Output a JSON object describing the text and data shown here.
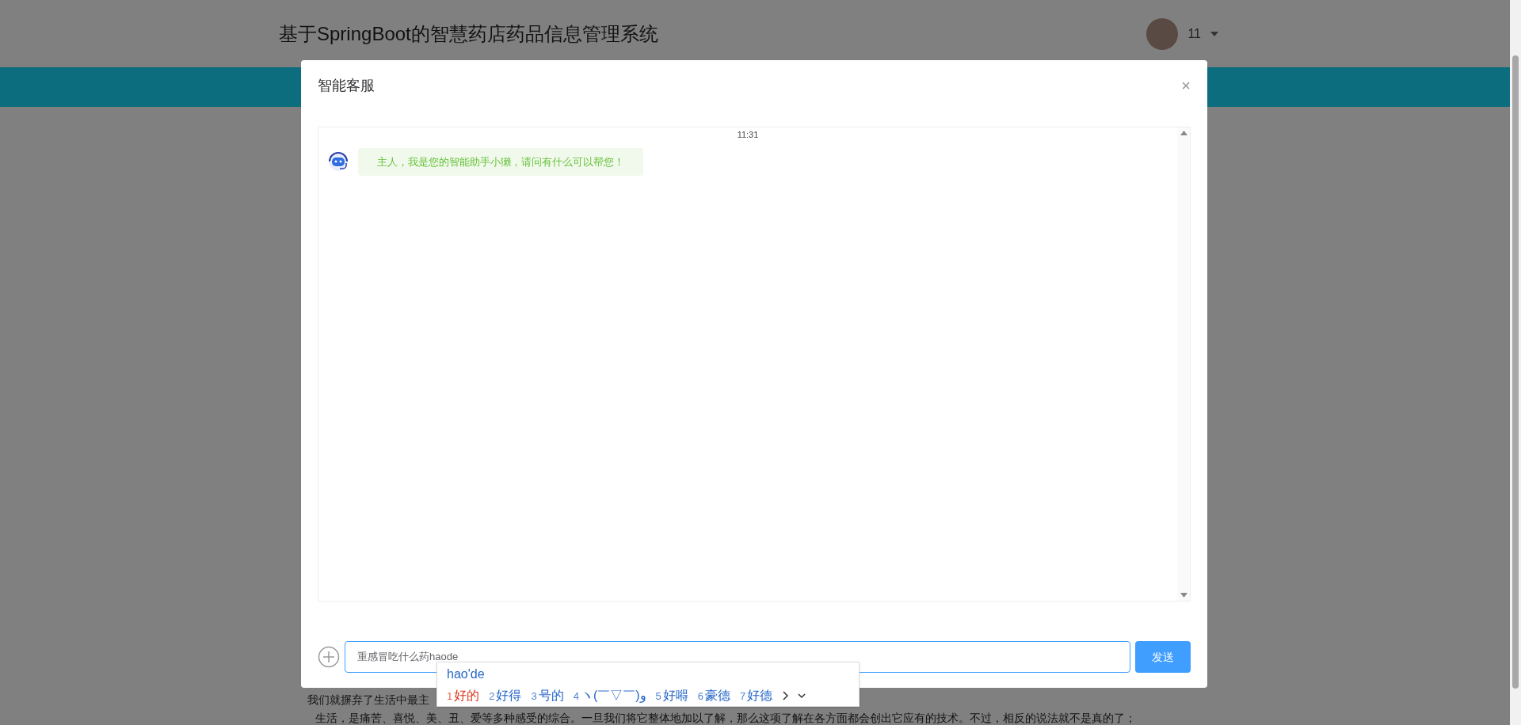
{
  "header": {
    "title": "基于SpringBoot的智慧药店药品信息管理系统",
    "user": {
      "name": "11"
    }
  },
  "background_text": [
    "我们就摒弃了生活中最主",
    "生活，是痛苦、喜悦、美、丑、爱等多种感受的综合。一旦我们将它整体地加以了解，那么这项了解在各方面都会创出它应有的技术。不过，相反的说法就不是真的了；"
  ],
  "dialog": {
    "title": "智能客服",
    "close": "×",
    "messages": [
      {
        "time": "11:31",
        "kind": "bot",
        "text": "主人，我是您的智能助手小獺，请问有什么可以帮您！"
      }
    ],
    "input": {
      "value": "重感冒吃什么药haode"
    },
    "send_button": "发送"
  },
  "ime": {
    "composition": "hao'de",
    "candidates": [
      {
        "index": "1",
        "text": "好的",
        "selected": true
      },
      {
        "index": "2",
        "text": "好得",
        "selected": false
      },
      {
        "index": "3",
        "text": "号的",
        "selected": false
      },
      {
        "index": "4",
        "text": "ヽ(￣▽￣)و",
        "selected": false
      },
      {
        "index": "5",
        "text": "好嘚",
        "selected": false
      },
      {
        "index": "6",
        "text": "豪德",
        "selected": false
      },
      {
        "index": "7",
        "text": "好德",
        "selected": false
      }
    ]
  }
}
